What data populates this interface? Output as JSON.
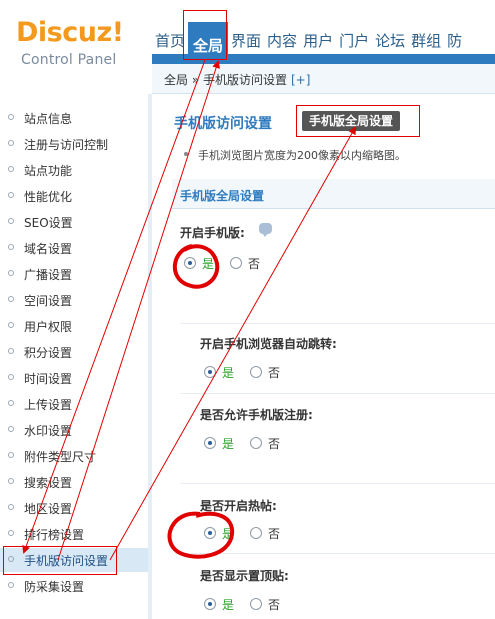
{
  "header": {
    "logo_main": "Discuz",
    "logo_mark": "!",
    "logo_sub": "Control Panel",
    "nav": [
      {
        "label": "首页",
        "active": false
      },
      {
        "label": "全局",
        "active": true
      },
      {
        "label": "界面",
        "active": false
      },
      {
        "label": "内容",
        "active": false
      },
      {
        "label": "用户",
        "active": false
      },
      {
        "label": "门户",
        "active": false
      },
      {
        "label": "论坛",
        "active": false
      },
      {
        "label": "群组",
        "active": false
      },
      {
        "label": "防",
        "active": false
      }
    ]
  },
  "breadcrumb": {
    "text": "全局 » 手机版访问设置",
    "add": "[+]"
  },
  "sidebar": {
    "items": [
      {
        "label": "站点信息"
      },
      {
        "label": "注册与访问控制"
      },
      {
        "label": "站点功能"
      },
      {
        "label": "性能优化"
      },
      {
        "label": "SEO设置"
      },
      {
        "label": "域名设置"
      },
      {
        "label": "广播设置"
      },
      {
        "label": "空间设置"
      },
      {
        "label": "用户权限"
      },
      {
        "label": "积分设置"
      },
      {
        "label": "时间设置"
      },
      {
        "label": "上传设置"
      },
      {
        "label": "水印设置"
      },
      {
        "label": "附件类型尺寸"
      },
      {
        "label": "搜索设置"
      },
      {
        "label": "地区设置"
      },
      {
        "label": "排行榜设置"
      },
      {
        "label": "手机版访问设置"
      },
      {
        "label": "防采集设置"
      }
    ],
    "active_index": 17
  },
  "main": {
    "title": "手机版访问设置",
    "tab_label": "手机版全局设置",
    "tip": "手机浏览图片宽度为200像素以内缩略图。",
    "section_title": "手机版全局设置",
    "yes": "是",
    "no": "否",
    "settings": [
      {
        "label": "开启手机版:",
        "value": "yes"
      },
      {
        "label": "开启手机浏览器自动跳转:",
        "value": "yes"
      },
      {
        "label": "是否允许手机版注册:",
        "value": "yes"
      },
      {
        "label": "是否开启热帖:",
        "value": "yes"
      },
      {
        "label": "是否显示置顶贴:",
        "value": "yes"
      }
    ]
  },
  "colors": {
    "accent": "#2e7bbf",
    "logo": "#f39a1e",
    "annotation": "#e00000",
    "yes_text": "#2aa12a"
  }
}
